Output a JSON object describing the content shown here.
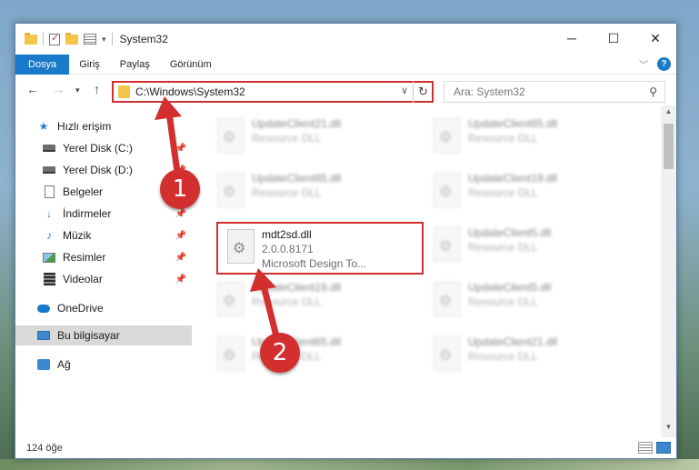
{
  "window": {
    "title": "System32",
    "qat_dropdown": "▾"
  },
  "ribbon": {
    "tabs": [
      "Dosya",
      "Giriş",
      "Paylaş",
      "Görünüm"
    ]
  },
  "address": {
    "path": "C:\\Windows\\System32",
    "search_placeholder": "Ara: System32"
  },
  "sidebar": {
    "items": [
      {
        "label": "Hızlı erişim"
      },
      {
        "label": "Yerel Disk (C:)"
      },
      {
        "label": "Yerel Disk (D:)"
      },
      {
        "label": "Belgeler"
      },
      {
        "label": "İndirmeler"
      },
      {
        "label": "Müzik"
      },
      {
        "label": "Resimler"
      },
      {
        "label": "Videolar"
      },
      {
        "label": "OneDrive"
      },
      {
        "label": "Bu bilgisayar"
      },
      {
        "label": "Ağ"
      }
    ]
  },
  "files": {
    "highlight": {
      "name": "mdt2sd.dll",
      "version": "2.0.0.8171",
      "description": "Microsoft Design To..."
    },
    "blurred": [
      {
        "name": "UpdateClient21.dll",
        "type": "Resource DLL"
      },
      {
        "name": "UpdateClient65.dll",
        "type": "Resource DLL"
      },
      {
        "name": "UpdateClient65.dll",
        "type": "Resource DLL"
      },
      {
        "name": "UpdateClient19.dll",
        "type": "Resource DLL"
      },
      {
        "name": "UpdateClient5.dll",
        "type": "Resource DLL"
      },
      {
        "name": "UpdateClient19.dll",
        "type": "Resource DLL"
      },
      {
        "name": "UpdateClient5.dll",
        "type": "Resource DLL"
      },
      {
        "name": "UpdateClient65.dll",
        "type": "Resource DLL"
      },
      {
        "name": "UpdateClient21.dll",
        "type": "Resource DLL"
      }
    ]
  },
  "status": {
    "count": "124 öğe"
  },
  "annotations": {
    "step1": "1",
    "step2": "2"
  },
  "colors": {
    "accent": "#1979ca",
    "highlight_red": "#d32f2f"
  }
}
